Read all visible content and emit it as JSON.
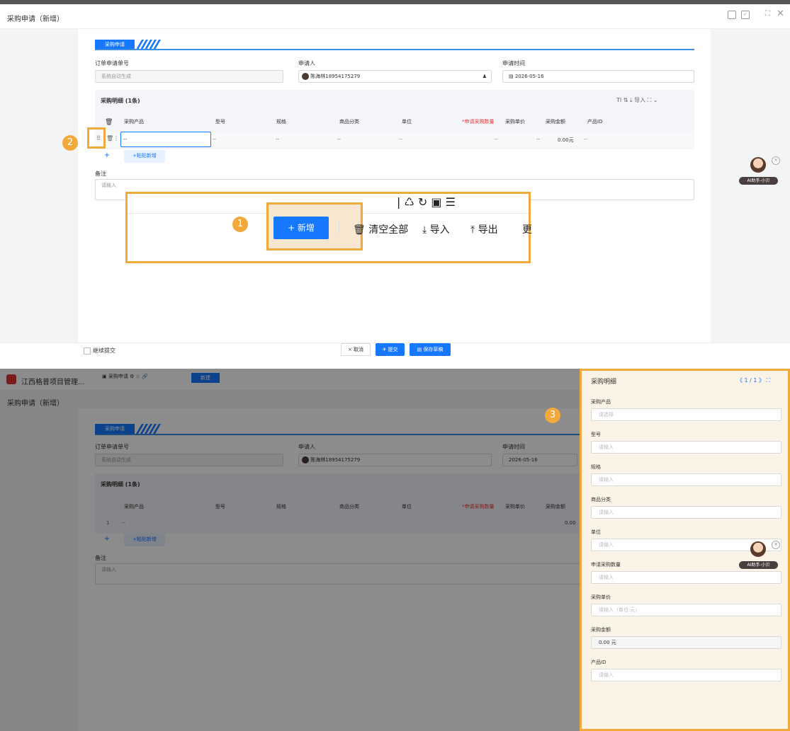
{
  "top": {
    "title": "采购申请（新增）",
    "window_icons": [
      "save-icon",
      "check-icon",
      "fullscreen-icon",
      "close-icon"
    ],
    "tab_label": "采购申请",
    "fields": {
      "order_no_label": "订单申请单号",
      "order_no_placeholder": "系统自动生成",
      "applicant_label": "申请人",
      "applicant_value": "陈海林18954175279",
      "time_label": "申请时间",
      "time_value": "2026-05-16"
    },
    "detail": {
      "title": "采购明细 (1条)",
      "toolbar": {
        "import": "导入"
      },
      "columns": [
        "采购产品",
        "型号",
        "规格",
        "商品分类",
        "单位",
        "*申请采购数量",
        "采购单价",
        "采购金额",
        "产品ID"
      ],
      "row": [
        "--",
        "--",
        "--",
        "--",
        "--",
        "--",
        "--",
        "0.00元",
        "--"
      ],
      "add_label": "+",
      "paste_add": "+粘贴新增"
    },
    "remark_label": "备注",
    "remark_placeholder": "请输入",
    "zoom": {
      "new_button": "+ 新增",
      "clear_all": "清空全部",
      "import": "导入",
      "export": "导出",
      "more": "更"
    },
    "badges": {
      "one": "1",
      "two": "2",
      "three": "3"
    },
    "continue_submit": "继续提交",
    "buttons": {
      "cancel": "× 取消",
      "submit": "提交",
      "save_draft": "保存草稿"
    },
    "ai_label": "AI助手-小贝"
  },
  "bottom": {
    "app_title": "江西格普项目管理...",
    "tab_label": "采购申请",
    "tab_chip": "新建",
    "title": "采购申请（新增）",
    "detail_title": "采购明细 (1条)",
    "row_index": "1",
    "amount": "0.00",
    "side": {
      "title": "采购明细",
      "pager": "1 / 1",
      "fields": [
        {
          "label": "采购产品",
          "placeholder": "请选择"
        },
        {
          "label": "型号",
          "placeholder": "请输入"
        },
        {
          "label": "规格",
          "placeholder": "请输入"
        },
        {
          "label": "商品分类",
          "placeholder": "请输入"
        },
        {
          "label": "单位",
          "placeholder": "请输入"
        },
        {
          "label": "申请采购数量",
          "placeholder": "请输入"
        },
        {
          "label": "采购单价",
          "placeholder": "请输入（单位:元）"
        },
        {
          "label": "采购金额",
          "placeholder": "0.00 元"
        },
        {
          "label": "产品ID",
          "placeholder": "请输入"
        }
      ]
    }
  },
  "colors": {
    "accent": "#1677ff",
    "highlight": "#f2a93b"
  }
}
